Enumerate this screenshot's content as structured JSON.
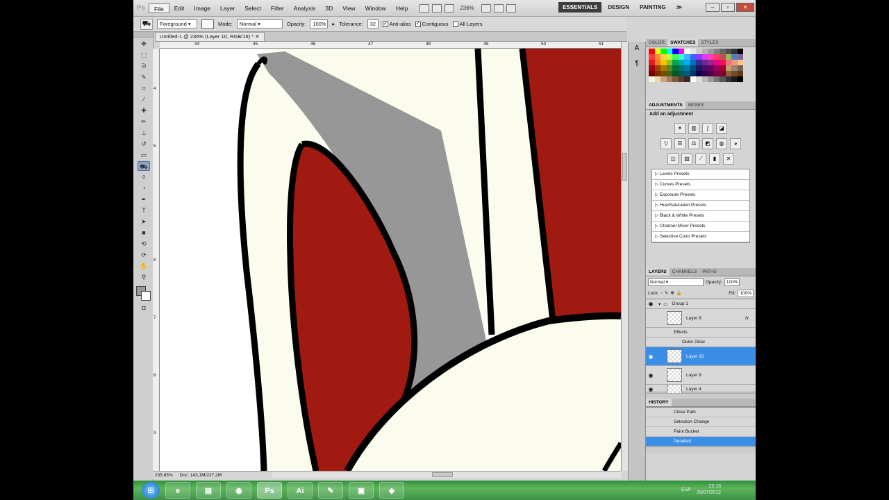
{
  "menubar": {
    "logo": "Ps",
    "items": [
      "File",
      "Edit",
      "Image",
      "Layer",
      "Select",
      "Filter",
      "Analysis",
      "3D",
      "View",
      "Window",
      "Help"
    ],
    "zoom": "236%",
    "workspaces": [
      "ESSENTIALS",
      "DESIGN",
      "PAINTING"
    ],
    "more": "≫",
    "window_controls": [
      "–",
      "▫",
      "✕"
    ]
  },
  "options": {
    "fill_source": "Foreground",
    "mode_label": "Mode:",
    "mode_value": "Normal",
    "opacity_label": "Opacity:",
    "opacity_value": "100%",
    "tolerance_label": "Tolerance:",
    "tolerance_value": "32",
    "antialias": "Anti-alias",
    "contiguous": "Contiguous",
    "all_layers": "All Layers"
  },
  "document": {
    "tab_title": "Untitled-1 @ 236% (Layer 10, RGB/16) *",
    "ruler_h_labels": [
      "44",
      "45",
      "46",
      "47",
      "48",
      "49",
      "50",
      "51"
    ],
    "ruler_v_labels": [
      "4",
      "5",
      "6",
      "7",
      "8",
      "9"
    ],
    "zoom_status": "235,83%",
    "doc_status": "Doc: 143,1M/227,2M"
  },
  "swatches_panel": {
    "tabs": [
      "COLOR",
      "SWATCHES",
      "STYLES"
    ],
    "colors": [
      "#ff0000",
      "#ffff00",
      "#00ff00",
      "#00ffff",
      "#0000ff",
      "#ff00ff",
      "#ffffff",
      "#e6e6e6",
      "#cccccc",
      "#b3b3b3",
      "#999999",
      "#808080",
      "#666666",
      "#4d4d4d",
      "#333333",
      "#000000",
      "#ff3b3b",
      "#ff8a3b",
      "#ffd13b",
      "#b8ff3b",
      "#3bff63",
      "#3bffd8",
      "#3bb8ff",
      "#3b63ff",
      "#8a3bff",
      "#d83bff",
      "#ff3bb8",
      "#ff3b63",
      "#c0504d",
      "#9bbb59",
      "#4f81bd",
      "#8064a2",
      "#e31a1c",
      "#f77b1e",
      "#f5c400",
      "#8dc21f",
      "#00a651",
      "#00a99d",
      "#00aeef",
      "#0072bc",
      "#2e3192",
      "#662d91",
      "#92278f",
      "#ec008c",
      "#ed145b",
      "#f26d7d",
      "#f7977a",
      "#fdc689",
      "#9e0b0f",
      "#a0410d",
      "#a67c00",
      "#598527",
      "#007236",
      "#00746b",
      "#0076a3",
      "#004a80",
      "#1b1464",
      "#440e62",
      "#630460",
      "#9e005d",
      "#9e0039",
      "#c69c6d",
      "#998675",
      "#736357",
      "#790000",
      "#7b2e00",
      "#7d4900",
      "#406618",
      "#005826",
      "#005952",
      "#005b7f",
      "#003663",
      "#0d004c",
      "#32004b",
      "#4b0049",
      "#7b0046",
      "#7a0026",
      "#8c6239",
      "#754c24",
      "#603913",
      "#f5f5dc",
      "#e8d5b5",
      "#c8a27a",
      "#a67b5b",
      "#7c5a3c",
      "#5c3d2e",
      "#3e2723",
      "#ffffff",
      "#dddddd",
      "#bbbbbb",
      "#999999",
      "#777777",
      "#555555",
      "#333333",
      "#1a1a1a",
      "#000000"
    ]
  },
  "adjustments_panel": {
    "tabs": [
      "ADJUSTMENTS",
      "MASKS"
    ],
    "title": "Add an adjustment",
    "presets": [
      "Levels Presets",
      "Curves Presets",
      "Exposure Presets",
      "Hue/Saturation Presets",
      "Black & White Presets",
      "Channel Mixer Presets",
      "Selective Color Presets"
    ]
  },
  "layers_panel": {
    "tabs": [
      "LAYERS",
      "CHANNELS",
      "PATHS"
    ],
    "blend_mode": "Normal",
    "opacity_label": "Opacity:",
    "opacity_value": "100%",
    "lock_label": "Lock:",
    "fill_label": "Fill:",
    "fill_value": "100%",
    "group_name": "Group 1",
    "layer_8": "Layer 8",
    "effects": "Effects",
    "outer_glow": "Outer Glow",
    "layer_10": "Layer 10",
    "layer_9": "Layer 9",
    "layer_4": "Layer 4",
    "fx": "fx"
  },
  "history_panel": {
    "tab": "HISTORY",
    "items": [
      "Close Path",
      "Selection Change",
      "Paint Bucket",
      "Deselect"
    ]
  },
  "taskbar": {
    "apps": [
      "e",
      "▤",
      "◉",
      "Ps",
      "Ai",
      "✎",
      "▣",
      "◆"
    ],
    "lang": "ESP",
    "time": "22:13",
    "date": "26/07/2012"
  },
  "colors": {
    "artwork_red": "#a01a12",
    "artwork_cream": "#fbfcee",
    "artwork_gray": "#979797",
    "selection_blue": "#3a8ee6"
  }
}
